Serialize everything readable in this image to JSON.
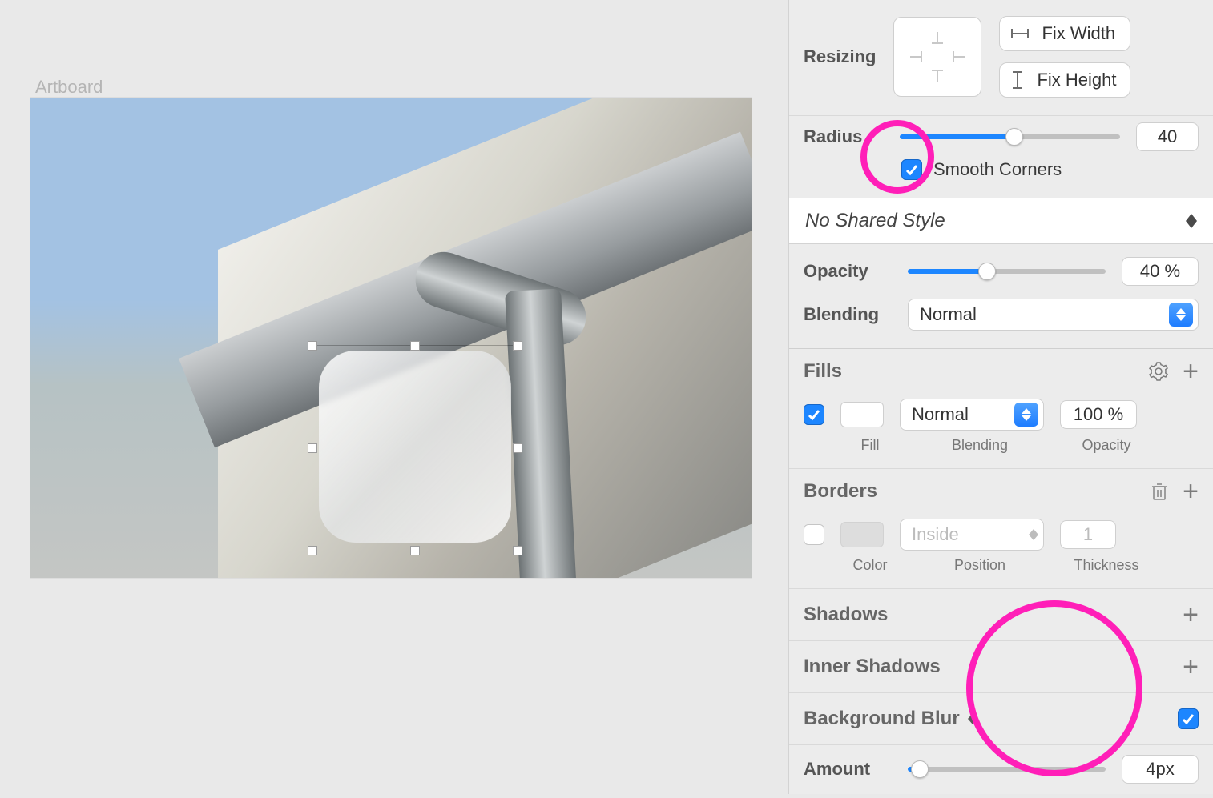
{
  "canvas": {
    "artboard_label": "Artboard"
  },
  "resizing": {
    "label": "Resizing",
    "fix_width": "Fix Width",
    "fix_height": "Fix Height"
  },
  "radius": {
    "label": "Radius",
    "value": "40",
    "slider_percent": "52%",
    "smooth_label": "Smooth Corners",
    "smooth_checked": true
  },
  "shared_style": {
    "label": "No Shared Style"
  },
  "opacity": {
    "label": "Opacity",
    "value": "40 %",
    "slider_percent": "40%"
  },
  "blending": {
    "label": "Blending",
    "mode": "Normal"
  },
  "fills": {
    "head": "Fills",
    "blending_mode": "Normal",
    "opacity_value": "100 %",
    "sub_fill": "Fill",
    "sub_blending": "Blending",
    "sub_opacity": "Opacity"
  },
  "borders": {
    "head": "Borders",
    "position": "Inside",
    "thickness": "1",
    "sub_color": "Color",
    "sub_position": "Position",
    "sub_thickness": "Thickness"
  },
  "shadows": {
    "head": "Shadows"
  },
  "inner_shadows": {
    "head": "Inner Shadows"
  },
  "bgblur": {
    "head": "Background Blur",
    "checked": true
  },
  "amount": {
    "label": "Amount",
    "value": "4px",
    "slider_percent": "6%"
  }
}
